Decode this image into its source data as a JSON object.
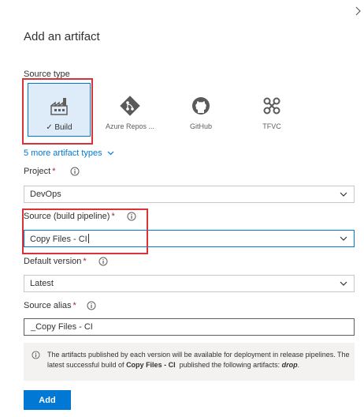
{
  "panel": {
    "title": "Add an artifact",
    "close_icon": "close-icon"
  },
  "source_type": {
    "label": "Source type",
    "tiles": [
      {
        "label": "Build",
        "selected": true,
        "icon": "build-icon"
      },
      {
        "label": "Azure Repos ...",
        "selected": false,
        "icon": "azure-repos-icon"
      },
      {
        "label": "GitHub",
        "selected": false,
        "icon": "github-icon"
      },
      {
        "label": "TFVC",
        "selected": false,
        "icon": "tfvc-icon"
      }
    ],
    "check_mark": "✓",
    "more_link": "5 more artifact types"
  },
  "project": {
    "label": "Project",
    "required": "*",
    "value": "DevOps"
  },
  "source": {
    "label": "Source (build pipeline)",
    "required": "*",
    "value": "Copy Files - CI"
  },
  "default_version": {
    "label": "Default version",
    "required": "*",
    "value": "Latest"
  },
  "source_alias": {
    "label": "Source alias",
    "required": "*",
    "value": "_Copy Files - CI"
  },
  "notice": {
    "text_1": "The artifacts published by each version will be available for deployment in release pipelines. The latest successful build of ",
    "bold_name": "Copy Files - CI",
    "text_2": "  published the following artifacts: ",
    "artifact": "drop",
    "text_3": "."
  },
  "actions": {
    "add_label": "Add"
  },
  "colors": {
    "accent": "#0078d4",
    "highlight_box": "#d9333a",
    "selected_tile_bg": "#deecf9",
    "required": "#a4262c"
  }
}
